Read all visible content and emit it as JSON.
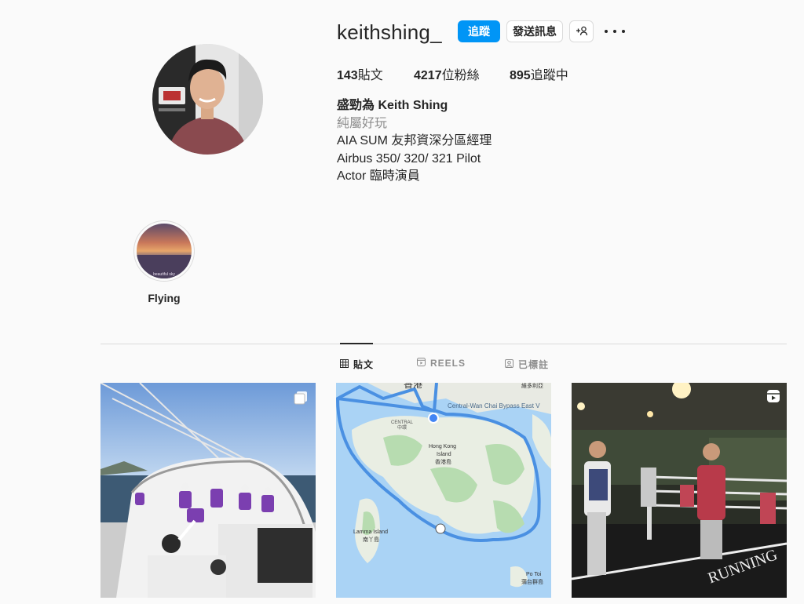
{
  "profile": {
    "username": "keithshing_",
    "follow_label": "追蹤",
    "message_label": "發送訊息",
    "add_user_icon": "add-user-icon",
    "more_icon": "more-options-icon"
  },
  "stats": {
    "posts_count": "143",
    "posts_label": "貼文",
    "followers_count": "4217",
    "followers_label": "位粉絲",
    "following_count": "895",
    "following_label": "追蹤中"
  },
  "bio": {
    "name": "盛勁為 Keith Shing",
    "category": "純屬好玩",
    "lines": [
      "AIA SUM 友邦資深分區經理",
      "Airbus 350/ 320/ 321 Pilot",
      "Actor 臨時演員"
    ]
  },
  "highlights": [
    {
      "label": "Flying",
      "caption": "beautiful sky"
    }
  ],
  "tabs": [
    {
      "label": "貼文",
      "icon": "grid-icon",
      "active": true
    },
    {
      "label": "REELS",
      "icon": "reels-icon",
      "active": false
    },
    {
      "label": "已標註",
      "icon": "tagged-icon",
      "active": false
    }
  ],
  "posts": [
    {
      "kind": "photo",
      "subject": "sailing crew on yacht",
      "badge": "carousel-icon"
    },
    {
      "kind": "map",
      "subject": "route around Hong Kong Island",
      "map_labels": {
        "top": "香港",
        "bypass": "Central-Wan Chai Bypass East V",
        "central": "CENTRAL",
        "central_zh": "中環",
        "hk_island": "Hong Kong",
        "hk_island2": "Island",
        "hk_island_zh": "香港島",
        "lamma": "Lamma Island",
        "lamma_zh": "南丫島",
        "potoi": "Po Toi",
        "potoi_zh": "蒲台群島",
        "top_right": "維多利亞"
      }
    },
    {
      "kind": "reel",
      "subject": "boxing ring event",
      "badge": "reels-icon",
      "ring_text": "RUNNING"
    }
  ],
  "colors": {
    "accent": "#0095f6",
    "text": "#262626",
    "muted": "#8e8e8e",
    "border": "#dbdbdb",
    "background": "#fafafa"
  }
}
